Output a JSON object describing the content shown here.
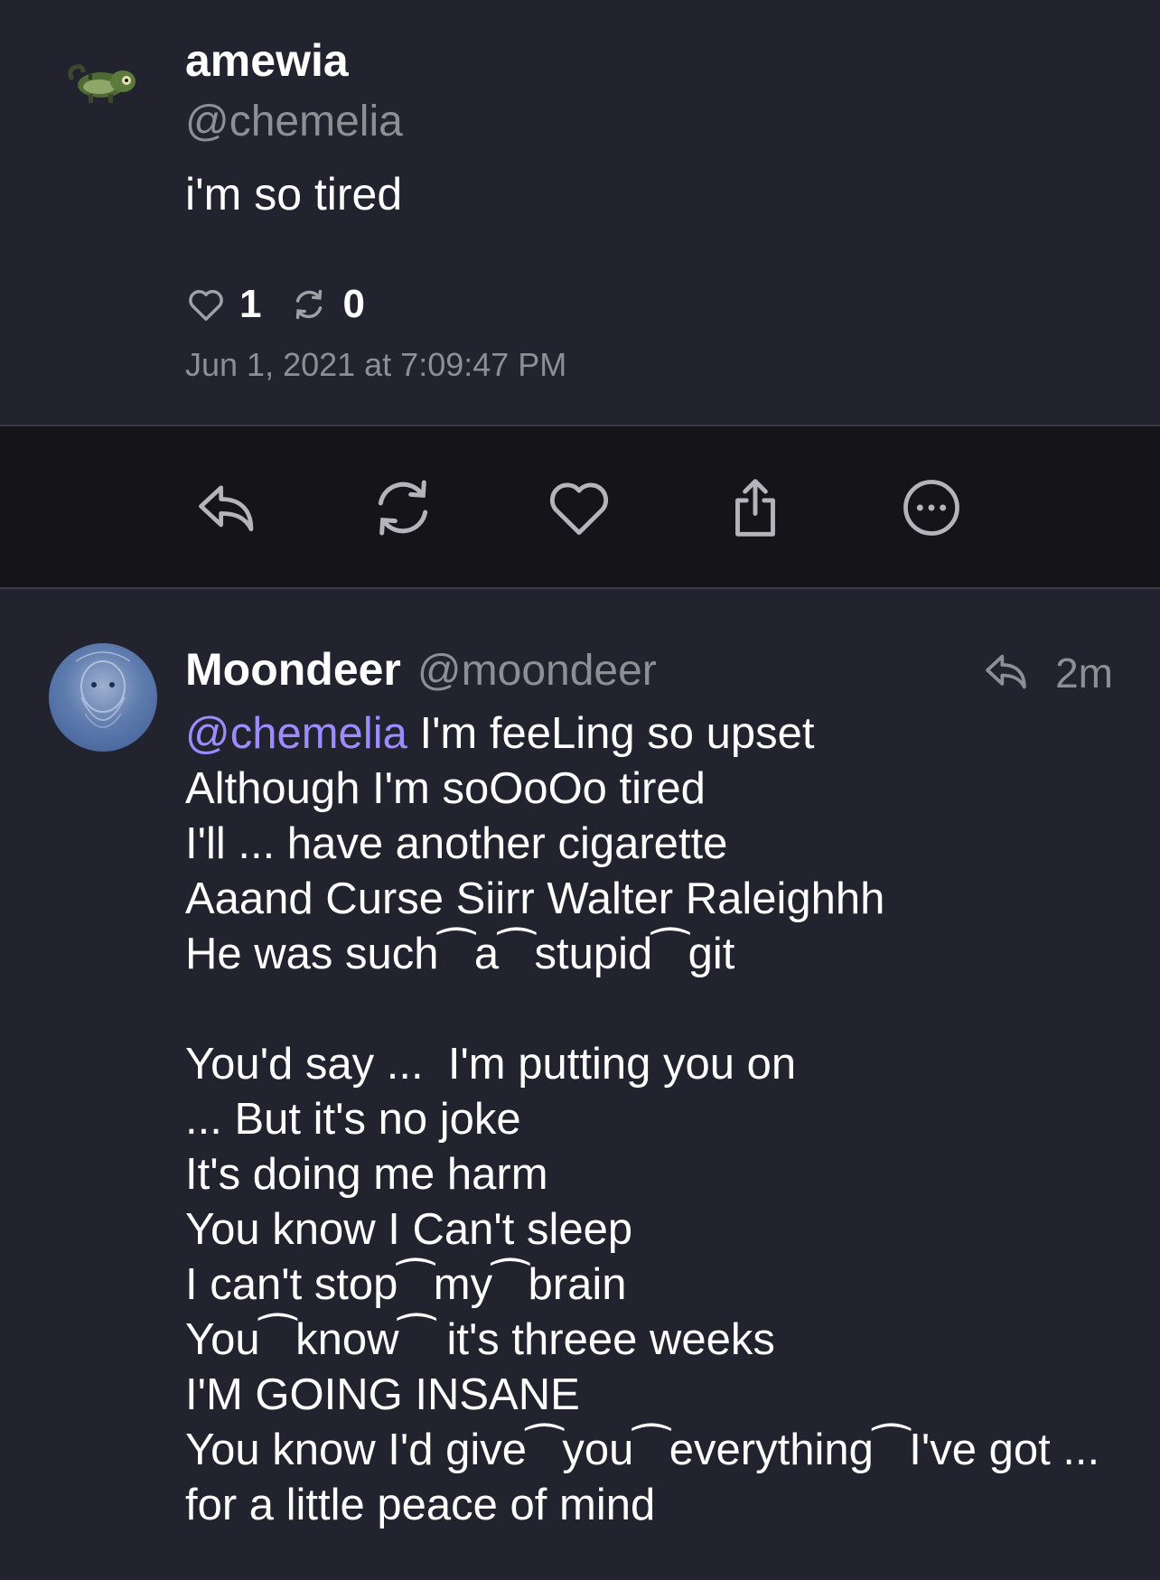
{
  "post": {
    "author_name": "amewia",
    "author_handle": "@chemelia",
    "text": "i'm so tired",
    "likes_count": "1",
    "reposts_count": "0",
    "timestamp": "Jun 1, 2021 at 7:09:47 PM",
    "avatar": "chameleon-pixel-avatar"
  },
  "action_bar": {
    "icons": [
      "reply-icon",
      "repost-icon",
      "like-icon",
      "share-icon",
      "more-icon"
    ]
  },
  "reply": {
    "author_name": "Moondeer",
    "author_handle": "@moondeer",
    "time_ago": "2m",
    "mention": "@chemelia",
    "first_line_rest": " I'm feeLing so upset",
    "body_rest": "Although I'm soOoOo tired\nI'll ... have another cigarette\nAaand Curse Siirr Walter Raleighhh\nHe was such⁀a⁀stupid⁀git\n\nYou'd say ...  I'm putting you on\n... But it's no joke\nIt's doing me harm\nYou know I Can't sleep\nI can't stop⁀my⁀brain\nYou⁀know⁀ it's threee weeks\nI'M GOING INSANE\nYou know I'd give⁀you⁀everything⁀I've got ... for a little peace of mind"
  },
  "colors": {
    "background": "#22232e",
    "action_bar": "#141419",
    "secondary_text": "#8e8e94",
    "mention": "#9b8cff"
  }
}
